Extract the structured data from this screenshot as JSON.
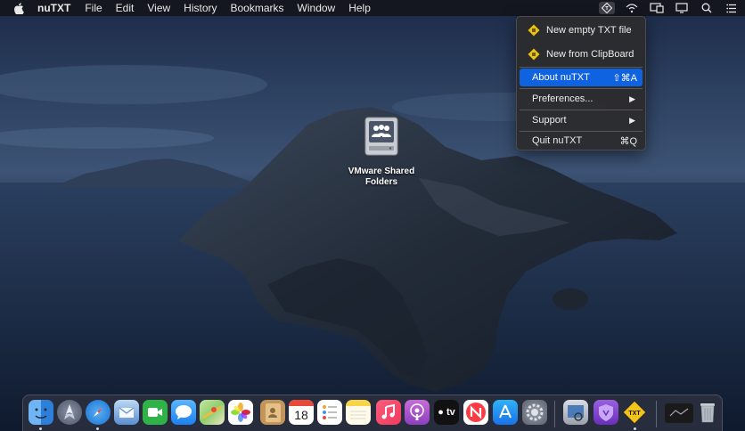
{
  "menubar": {
    "app_name": "nuTXT",
    "menus": [
      "File",
      "Edit",
      "View",
      "History",
      "Bookmarks",
      "Window",
      "Help"
    ],
    "status_icons": [
      "nutxt-status-icon",
      "airdrop-icon",
      "display-icon",
      "screen-mirror-icon",
      "search-icon",
      "control-center-icon"
    ]
  },
  "dropdown": {
    "new_empty": "New empty TXT file",
    "new_clipboard": "New from ClipBoard",
    "about": "About nuTXT",
    "about_shortcut": "⇧⌘A",
    "preferences": "Preferences...",
    "support": "Support",
    "quit": "Quit nuTXT",
    "quit_shortcut": "⌘Q"
  },
  "desktop": {
    "shared_folder_label_1": "VMware Shared",
    "shared_folder_label_2": "Folders"
  },
  "dock": {
    "apps": [
      "finder-icon",
      "launchpad-icon",
      "safari-icon",
      "mail-icon",
      "facetime-icon",
      "messages-icon",
      "maps-icon",
      "photos-icon",
      "contacts-icon",
      "calendar-icon",
      "reminders-icon",
      "notes-icon",
      "music-icon",
      "podcasts-icon",
      "tv-icon",
      "news-icon",
      "app-store-icon",
      "system-preferences-icon",
      "preview-icon",
      "shield-icon",
      "nutxt-dock-icon",
      "screenshot-icon",
      "trash-icon"
    ],
    "calendar_day": "18",
    "tv_label": "tv",
    "nutxt_label": "TXT"
  },
  "colors": {
    "highlight": "#1063e0",
    "menubar": "#14161c",
    "dropdown_bg": "#2c2c2e"
  }
}
